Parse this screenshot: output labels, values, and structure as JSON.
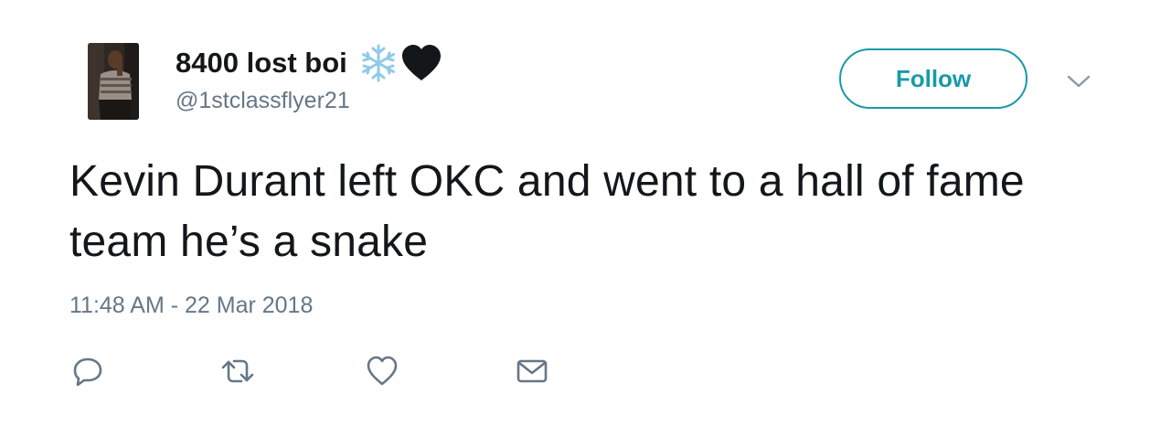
{
  "user": {
    "display_name": "8400 lost boi",
    "handle": "@1stclassflyer21",
    "name_emojis": [
      "snowflake-icon",
      "black-heart-icon"
    ],
    "avatar": "profile-photo"
  },
  "header": {
    "follow_label": "Follow",
    "menu_icon": "chevron-down-icon"
  },
  "tweet": {
    "text": "Kevin Durant left OKC and went to a hall of fame team he’s a snake",
    "timestamp": "11:48 AM - 22 Mar 2018"
  },
  "actions": [
    "reply-icon",
    "retweet-icon",
    "like-icon",
    "direct-message-icon"
  ],
  "colors": {
    "text": "#14171a",
    "secondary": "#657786",
    "accent": "#1a9aa8",
    "snowflake": "#8ecbe8"
  }
}
